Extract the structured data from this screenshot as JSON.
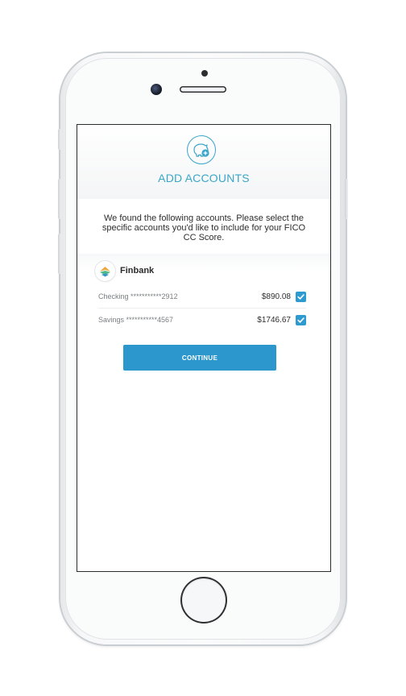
{
  "header": {
    "icon": "piggy-bank-add-icon",
    "title": "ADD ACCOUNTS"
  },
  "intro_text": "We found the following accounts. Please select the specific accounts you'd like to include for your FICO CC Score.",
  "bank": {
    "logo": "finbank-logo",
    "name": "Finbank",
    "accounts": [
      {
        "label": "Checking ***********2912",
        "amount": "$890.08",
        "checked": true
      },
      {
        "label": "Savings ***********4567",
        "amount": "$1746.67",
        "checked": true
      }
    ]
  },
  "continue_label": "CONTINUE",
  "colors": {
    "accent": "#3aa6c9",
    "button": "#2b97cd",
    "checkbox": "#2d9ad0"
  }
}
